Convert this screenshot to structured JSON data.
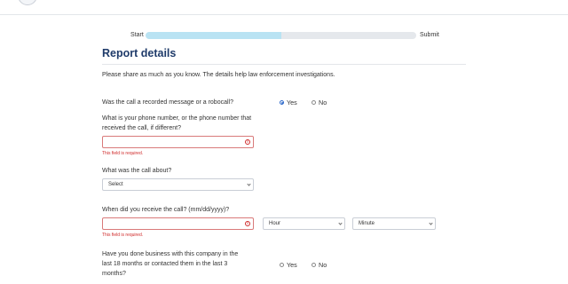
{
  "progress": {
    "start_label": "Start",
    "end_label": "Submit",
    "value_fraction": 0.5
  },
  "page": {
    "title": "Report details",
    "intro": "Please share as much as you know. The details help law enforcement investigations."
  },
  "q_robocall": {
    "label": "Was the call a recorded message or a robocall?",
    "options": [
      {
        "label": "Yes",
        "selected": true
      },
      {
        "label": "No",
        "selected": false
      }
    ]
  },
  "q_phone": {
    "label_line1": "What is your phone number, or the phone number that",
    "label_line2": "received the call, if different?",
    "value": "",
    "error": "This field is required."
  },
  "q_about": {
    "label": "What was the call about?",
    "select_value": "Select"
  },
  "q_date": {
    "label": "When did you receive the call? (mm/dd/yyyy)?",
    "value": "",
    "error": "This field is required.",
    "hour_value": "Hour",
    "minute_value": "Minute"
  },
  "q_business": {
    "label_line1": "Have you done business with this company in the",
    "label_line2": "last 18 months or contacted them in the last 3",
    "label_line3": "months?",
    "options": [
      {
        "label": "Yes",
        "selected": false
      },
      {
        "label": "No",
        "selected": false
      }
    ]
  },
  "colors": {
    "accent": "#1f3b6a",
    "error": "#d02b2b",
    "progress_fill": "#b9e3f3",
    "radio_selected": "#2a67c9"
  },
  "icons": {
    "error_icon": "exclamation-circle",
    "select_arrow": "chevron-down"
  }
}
